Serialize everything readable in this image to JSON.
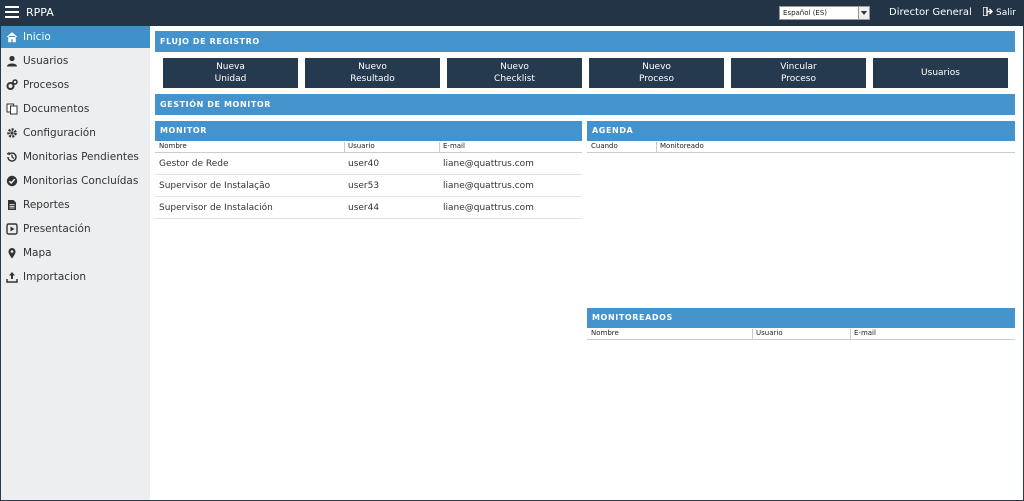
{
  "app": {
    "title": "RPPA"
  },
  "header": {
    "language": "Español (ES)",
    "user": "Director General",
    "logout_label": "Salir"
  },
  "sidebar": {
    "items": [
      {
        "label": "Inicio",
        "icon": "home-icon",
        "active": true
      },
      {
        "label": "Usuarios",
        "icon": "user-icon"
      },
      {
        "label": "Procesos",
        "icon": "cogs-icon"
      },
      {
        "label": "Documentos",
        "icon": "documents-icon"
      },
      {
        "label": "Configuración",
        "icon": "gear-icon"
      },
      {
        "label": "Monitorias Pendientes",
        "icon": "history-icon"
      },
      {
        "label": "Monitorias Concluídas",
        "icon": "check-circle-icon"
      },
      {
        "label": "Reportes",
        "icon": "file-text-icon"
      },
      {
        "label": "Presentación",
        "icon": "play-square-icon"
      },
      {
        "label": "Mapa",
        "icon": "map-marker-icon"
      },
      {
        "label": "Importacion",
        "icon": "upload-icon"
      }
    ]
  },
  "flow": {
    "title": "FLUJO DE REGISTRO",
    "buttons": [
      "Nueva\nUnidad",
      "Nuevo\nResultado",
      "Nuevo\nChecklist",
      "Nuevo\nProceso",
      "Vincular\nProceso",
      "Usuarios"
    ]
  },
  "monitor_mgmt": {
    "title": "GESTIÓN DE MONITOR"
  },
  "monitor": {
    "title": "MONITOR",
    "columns": [
      "Nombre",
      "Usuario",
      "E-mail"
    ],
    "rows": [
      [
        "Gestor de Rede",
        "user40",
        "liane@quattrus.com"
      ],
      [
        "Supervisor de Instalação",
        "user53",
        "liane@quattrus.com"
      ],
      [
        "Supervisor de Instalación",
        "user44",
        "liane@quattrus.com"
      ]
    ]
  },
  "agenda": {
    "title": "AGENDA",
    "columns": [
      "Cuando",
      "Monitoreado"
    ]
  },
  "monitoreados": {
    "title": "MONITOREADOS",
    "columns": [
      "Nombre",
      "Usuario",
      "E-mail"
    ]
  }
}
